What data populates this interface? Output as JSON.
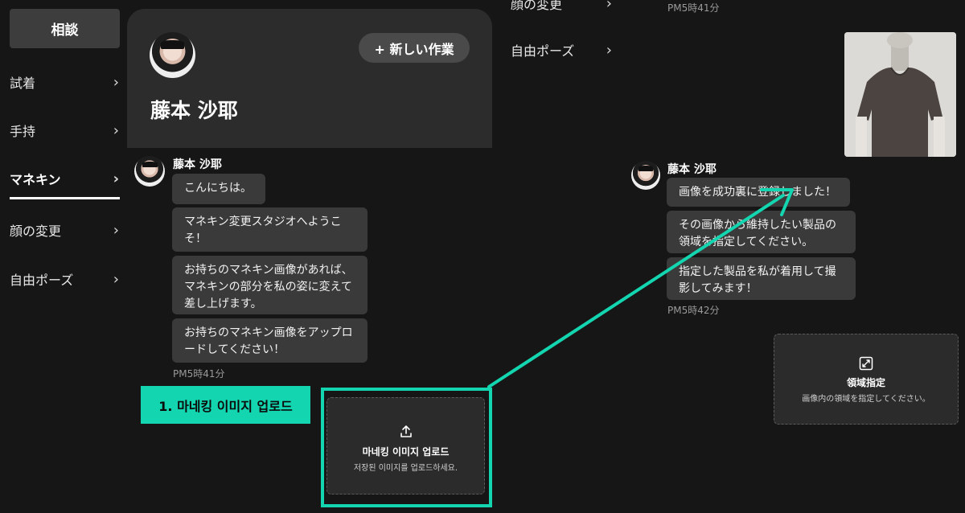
{
  "sidebar": {
    "consult_label": "相談",
    "items": [
      {
        "label": "試着",
        "active": false
      },
      {
        "label": "手持",
        "active": false
      },
      {
        "label": "マネキン",
        "active": true
      },
      {
        "label": "顔の変更",
        "active": false
      },
      {
        "label": "自由ポーズ",
        "active": false
      }
    ]
  },
  "profile": {
    "name": "藤本 沙耶",
    "new_task_label": "+ 新しい作業"
  },
  "chat_left": {
    "sender": "藤本 沙耶",
    "messages": [
      "こんにちは。",
      "マネキン変更スタジオへようこそ！",
      "お持ちのマネキン画像があれば、マネキンの部分を私の姿に変えて差し上げます。",
      "お持ちのマネキン画像をアップロードしてください！"
    ],
    "timestamp": "PM5時41分"
  },
  "annotation": {
    "step_label": "1. 마네킹 이미지 업로드",
    "accent_color": "#13d6b0"
  },
  "upload_box": {
    "title": "마네킹 이미지 업로드",
    "subtitle": "저장된 이미지를 업로드하세요."
  },
  "right_panel": {
    "menu_items": [
      "顔の変更",
      "自由ポーズ"
    ],
    "top_timestamp": "PM5時41分",
    "sender": "藤本 沙耶",
    "messages": [
      "画像を成功裏に登録しました！",
      "その画像から維持したい製品の領域を指定してください。",
      "指定した製品を私が着用して撮影してみます！"
    ],
    "timestamp": "PM5時42分",
    "area_box": {
      "title": "領域指定",
      "subtitle": "画像内の領域を指定してください。"
    }
  }
}
